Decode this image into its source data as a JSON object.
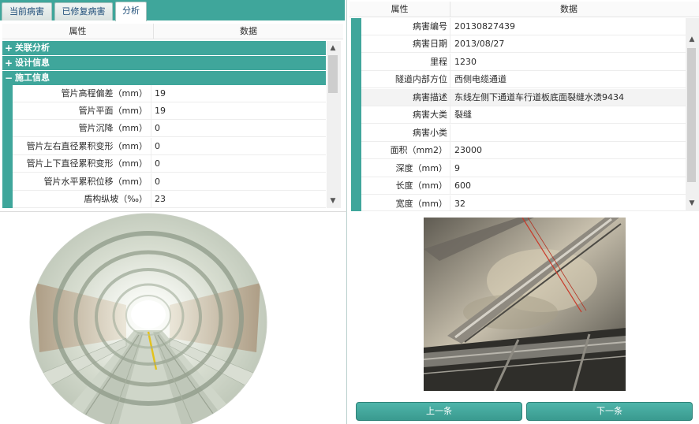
{
  "tabs": [
    {
      "label": "当前病害"
    },
    {
      "label": "已修复病害"
    },
    {
      "label": "分析"
    }
  ],
  "left_grid": {
    "header_attr": "属性",
    "header_data": "数据",
    "categories": [
      {
        "sign": "+",
        "label": "关联分析"
      },
      {
        "sign": "+",
        "label": "设计信息"
      },
      {
        "sign": "−",
        "label": "施工信息"
      }
    ],
    "rows": [
      {
        "key": "管片高程偏差（mm）",
        "value": "19"
      },
      {
        "key": "管片平面（mm）",
        "value": "19"
      },
      {
        "key": "管片沉降（mm）",
        "value": "0"
      },
      {
        "key": "管片左右直径累积变形（mm）",
        "value": "0"
      },
      {
        "key": "管片上下直径累积变形（mm）",
        "value": "0"
      },
      {
        "key": "管片水平累积位移（mm）",
        "value": "0"
      },
      {
        "key": "盾构纵坡（‰）",
        "value": "23"
      }
    ]
  },
  "right_grid": {
    "header_attr": "属性",
    "header_data": "数据",
    "rows": [
      {
        "key": "病害编号",
        "value": "20130827439"
      },
      {
        "key": "病害日期",
        "value": "2013/08/27"
      },
      {
        "key": "里程",
        "value": "1230"
      },
      {
        "key": "隧道内部方位",
        "value": "西侧电缆通道"
      },
      {
        "key": "病害描述",
        "value": "东线左侧下通道车行道板底面裂缝水渍9434"
      },
      {
        "key": "病害大类",
        "value": "裂缝"
      },
      {
        "key": "病害小类",
        "value": ""
      },
      {
        "key": "面积（mm2）",
        "value": "23000"
      },
      {
        "key": "深度（mm）",
        "value": "9"
      },
      {
        "key": "长度（mm）",
        "value": "600"
      },
      {
        "key": "宽度（mm）",
        "value": "32"
      }
    ]
  },
  "nav": {
    "prev_label": "上一条",
    "next_label": "下一条"
  },
  "colors": {
    "accent": "#3fa69b",
    "accent_dark": "#2f8278"
  },
  "icons": {
    "expand": "plus-icon",
    "collapse": "minus-icon",
    "scroll_up": "chevron-up-icon",
    "scroll_down": "chevron-down-icon"
  }
}
